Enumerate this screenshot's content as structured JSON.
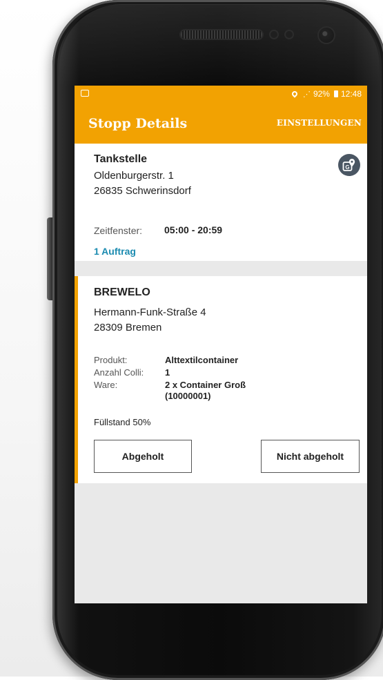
{
  "status_bar": {
    "battery": "92%",
    "time": "12:48"
  },
  "app_bar": {
    "title": "Stopp Details",
    "settings_label": "EINSTELLUNGEN"
  },
  "stop": {
    "name": "Tankstelle",
    "street": "Oldenburgerstr. 1",
    "city": "26835 Schwerinsdorf",
    "time_window_label": "Zeitfenster:",
    "time_window_value": "05:00 - 20:59",
    "orders_link": "1 Auftrag"
  },
  "order": {
    "customer": "BREWELO",
    "street": "Hermann-Funk-Straße 4",
    "city": "28309 Bremen",
    "product_label": "Produkt:",
    "product_value": "Alttextilcontainer",
    "colli_label": "Anzahl Colli:",
    "colli_value": "1",
    "goods_label": "Ware:",
    "goods_value_line1": "2 x Container Groß",
    "goods_value_line2": "(10000001)",
    "fill_level": "Füllstand 50%",
    "picked_button": "Abgeholt",
    "not_picked_button": "Nicht abgeholt"
  },
  "colors": {
    "accent": "#f2a202",
    "link": "#1b8bb0",
    "map_button": "#4a5663"
  },
  "icons": {
    "map": "map-pin-icon"
  }
}
